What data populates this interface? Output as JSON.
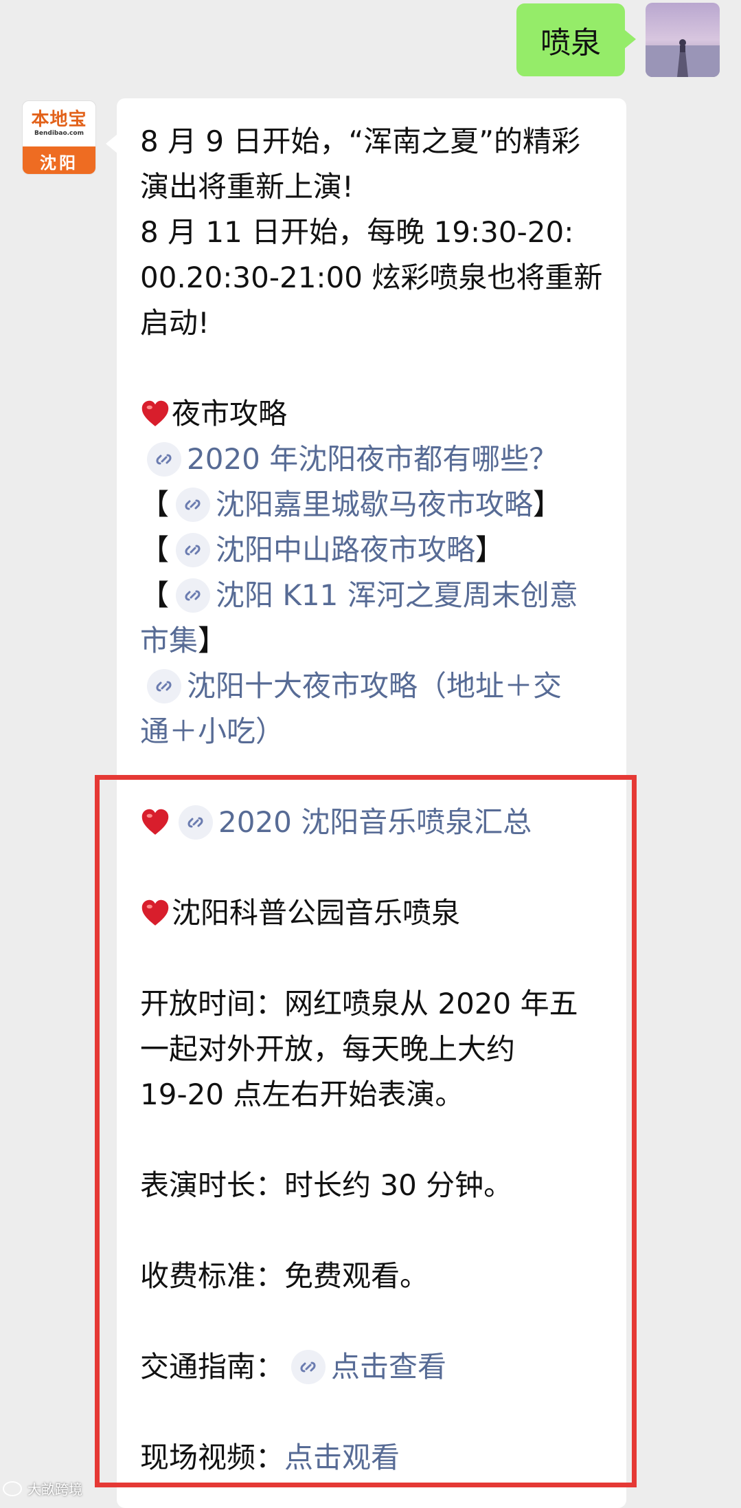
{
  "outgoing": {
    "text": "喷泉"
  },
  "bot_avatar": {
    "brand": "本地宝",
    "domain": "Bendibao.com",
    "city": "沈阳"
  },
  "message": {
    "intro_lines": [
      "8 月 9 日开始，“浑南之夏”的精彩",
      "演出将重新上演!",
      "8 月 11 日开始，每晚 19:30-20:",
      "00.20:30-21:00 炫彩喷泉也将重新",
      "启动!"
    ],
    "night_market_heading": "夜市攻略",
    "links": {
      "l1": "2020 年沈阳夜市都有哪些？",
      "l2": "沈阳嘉里城歇马夜市攻略",
      "l3": "沈阳中山路夜市攻略",
      "l4a": "沈阳 K11 浑河之夏周末创意",
      "l4b": "市集",
      "l5a": "沈阳十大夜市攻略（地址＋交",
      "l5b": "通＋小吃）",
      "fountain_summary": "2020 沈阳音乐喷泉汇总",
      "traffic_link": "点击查看",
      "video_link": "点击观看"
    },
    "bracket_open": "【",
    "bracket_close": "】",
    "park_heading": "沈阳科普公园音乐喷泉",
    "open_time_lines": [
      "开放时间：网红喷泉从 2020 年五",
      "一起对外开放，每天晚上大约",
      "19-20 点左右开始表演。"
    ],
    "duration": "表演时长：时长约 30 分钟。",
    "fee": "收费标准：免费观看。",
    "traffic_label": "交通指南：",
    "video_label": "现场视频："
  },
  "watermark": "大畝跨境",
  "colors": {
    "outgoing_bubble": "#95ec69",
    "link": "#576b95",
    "highlight": "#e53935",
    "background": "#ededed"
  },
  "icons": [
    "mini-program-icon",
    "heart-icon"
  ]
}
